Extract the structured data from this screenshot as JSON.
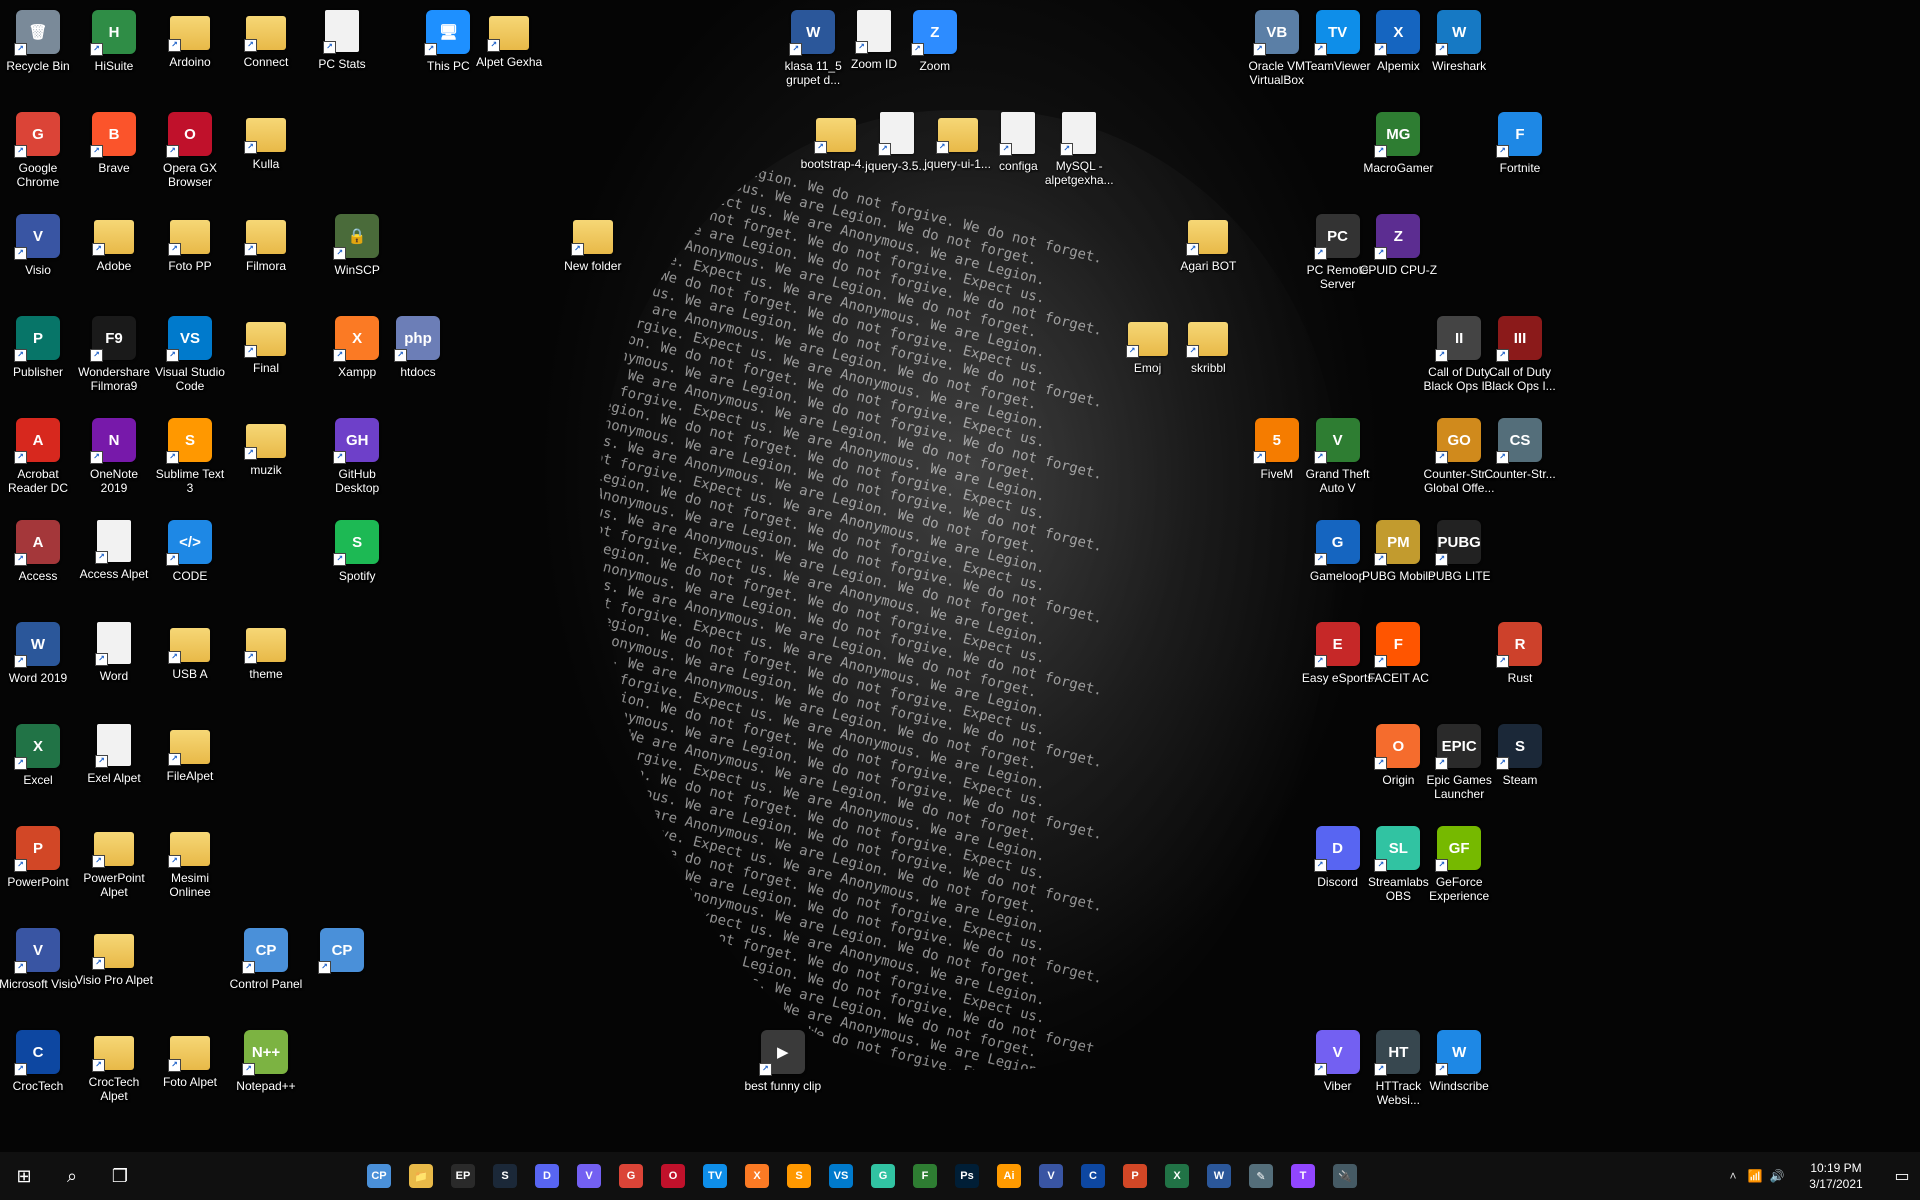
{
  "colors": {
    "taskbar": "#101010",
    "accent": "#0078d7"
  },
  "wallpaper": {
    "lines": [
      "We are Anonymous. We are Legion. We do not forgive. We do not forget.",
      "Expect us. We are Anonymous. We are Legion. We do not forget.",
      "We do not forgive. Expect us. We are Anonymous. We are Legion.",
      "We are Legion. We do not forget. We do not forgive. Expect us.",
      "We are Anonymous. We are Legion. We do not forgive. We do not forget.",
      "Expect us. We are Anonymous. We are Legion. We do not forget.",
      "We do not forgive. Expect us. We are Anonymous. We are Legion.",
      "We are Legion. We do not forget. We do not forgive. Expect us."
    ]
  },
  "desktop_icons": [
    {
      "label": "Recycle Bin",
      "abbr": "🗑",
      "color": "#7a8a99",
      "kind": "app"
    },
    {
      "label": "HiSuite",
      "abbr": "H",
      "color": "#2f8d46",
      "kind": "app"
    },
    {
      "label": "Ardoino",
      "abbr": "",
      "color": "",
      "kind": "folder"
    },
    {
      "label": "Connect",
      "abbr": "",
      "color": "",
      "kind": "folder"
    },
    {
      "label": "PC Stats",
      "abbr": "",
      "color": "",
      "kind": "doc"
    },
    {
      "label": "This PC",
      "abbr": "🖥",
      "color": "#1e90ff",
      "kind": "app"
    },
    {
      "label": "Alpet Gexha",
      "abbr": "",
      "color": "",
      "kind": "folder"
    },
    {
      "label": "klasa 11_5 grupet d...",
      "abbr": "W",
      "color": "#2b579a",
      "kind": "app"
    },
    {
      "label": "Zoom ID",
      "abbr": "",
      "color": "",
      "kind": "doc"
    },
    {
      "label": "Zoom",
      "abbr": "Z",
      "color": "#2d8cff",
      "kind": "app"
    },
    {
      "label": "Oracle VM VirtualBox",
      "abbr": "VB",
      "color": "#5b7fa6",
      "kind": "app"
    },
    {
      "label": "TeamViewer",
      "abbr": "TV",
      "color": "#0e8ee9",
      "kind": "app"
    },
    {
      "label": "Alpemix",
      "abbr": "X",
      "color": "#1565c0",
      "kind": "app"
    },
    {
      "label": "Wireshark",
      "abbr": "W",
      "color": "#1679c4",
      "kind": "app"
    },
    {
      "label": "Google Chrome",
      "abbr": "G",
      "color": "#db4437",
      "kind": "app"
    },
    {
      "label": "Brave",
      "abbr": "B",
      "color": "#fb542b",
      "kind": "app"
    },
    {
      "label": "Opera GX Browser",
      "abbr": "O",
      "color": "#c0112b",
      "kind": "app"
    },
    {
      "label": "Kulla",
      "abbr": "",
      "color": "",
      "kind": "folder"
    },
    {
      "label": "bootstrap-4...",
      "abbr": "",
      "color": "",
      "kind": "folder"
    },
    {
      "label": "jquery-3.5...",
      "abbr": "",
      "color": "",
      "kind": "doc"
    },
    {
      "label": "jquery-ui-1...",
      "abbr": "",
      "color": "",
      "kind": "folder"
    },
    {
      "label": "configa",
      "abbr": "",
      "color": "",
      "kind": "doc"
    },
    {
      "label": "MySQL - alpetgexha...",
      "abbr": "",
      "color": "",
      "kind": "doc"
    },
    {
      "label": "MacroGamer",
      "abbr": "MG",
      "color": "#2e7d32",
      "kind": "app"
    },
    {
      "label": "Fortnite",
      "abbr": "F",
      "color": "#1e88e5",
      "kind": "app"
    },
    {
      "label": "Visio",
      "abbr": "V",
      "color": "#3955a3",
      "kind": "app"
    },
    {
      "label": "Adobe",
      "abbr": "",
      "color": "",
      "kind": "folder"
    },
    {
      "label": "Foto PP",
      "abbr": "",
      "color": "",
      "kind": "folder"
    },
    {
      "label": "Filmora",
      "abbr": "",
      "color": "",
      "kind": "folder"
    },
    {
      "label": "WinSCP",
      "abbr": "🔒",
      "color": "#4a6b3a",
      "kind": "app"
    },
    {
      "label": "New folder",
      "abbr": "",
      "color": "",
      "kind": "folder"
    },
    {
      "label": "Agari BOT",
      "abbr": "",
      "color": "",
      "kind": "folder"
    },
    {
      "label": "PC Remote Server",
      "abbr": "PC",
      "color": "#333333",
      "kind": "app"
    },
    {
      "label": "CPUID CPU-Z",
      "abbr": "Z",
      "color": "#5c2d91",
      "kind": "app"
    },
    {
      "label": "Publisher",
      "abbr": "P",
      "color": "#077568",
      "kind": "app"
    },
    {
      "label": "Wondershare Filmora9",
      "abbr": "F9",
      "color": "#1a1a1a",
      "kind": "app"
    },
    {
      "label": "Visual Studio Code",
      "abbr": "VS",
      "color": "#007acc",
      "kind": "app"
    },
    {
      "label": "Final",
      "abbr": "",
      "color": "",
      "kind": "folder"
    },
    {
      "label": "Xampp",
      "abbr": "X",
      "color": "#fb7a24",
      "kind": "app"
    },
    {
      "label": "htdocs",
      "abbr": "php",
      "color": "#6c7eb7",
      "kind": "app"
    },
    {
      "label": "Emoj",
      "abbr": "",
      "color": "",
      "kind": "folder"
    },
    {
      "label": "skribbl",
      "abbr": "",
      "color": "",
      "kind": "folder"
    },
    {
      "label": "Call of Duty Black Ops I...",
      "abbr": "II",
      "color": "#444444",
      "kind": "app"
    },
    {
      "label": "Call of Duty Black Ops I...",
      "abbr": "III",
      "color": "#8b1a1a",
      "kind": "app"
    },
    {
      "label": "Acrobat Reader DC",
      "abbr": "A",
      "color": "#d7281e",
      "kind": "app"
    },
    {
      "label": "OneNote 2019",
      "abbr": "N",
      "color": "#7719aa",
      "kind": "app"
    },
    {
      "label": "Sublime Text 3",
      "abbr": "S",
      "color": "#ff9800",
      "kind": "app"
    },
    {
      "label": "muzik",
      "abbr": "",
      "color": "",
      "kind": "folder"
    },
    {
      "label": "GitHub Desktop",
      "abbr": "GH",
      "color": "#6e40c9",
      "kind": "app"
    },
    {
      "label": "FiveM",
      "abbr": "5",
      "color": "#f57c00",
      "kind": "app"
    },
    {
      "label": "Grand Theft Auto V",
      "abbr": "V",
      "color": "#2e7d32",
      "kind": "app"
    },
    {
      "label": "Counter-Str... Global Offe...",
      "abbr": "GO",
      "color": "#d08a1c",
      "kind": "app"
    },
    {
      "label": "Counter-Str...",
      "abbr": "CS",
      "color": "#546e7a",
      "kind": "app"
    },
    {
      "label": "Access",
      "abbr": "A",
      "color": "#a4373a",
      "kind": "app"
    },
    {
      "label": "Access Alpet",
      "abbr": "",
      "color": "",
      "kind": "doc"
    },
    {
      "label": "CODE",
      "abbr": "</>",
      "color": "#1e88e5",
      "kind": "app"
    },
    {
      "label": "Spotify",
      "abbr": "S",
      "color": "#1db954",
      "kind": "app"
    },
    {
      "label": "Gameloop",
      "abbr": "G",
      "color": "#1565c0",
      "kind": "app"
    },
    {
      "label": "PUBG Mobile",
      "abbr": "PM",
      "color": "#c29b2e",
      "kind": "app"
    },
    {
      "label": "PUBG LITE",
      "abbr": "PUBG",
      "color": "#222222",
      "kind": "app"
    },
    {
      "label": "Word 2019",
      "abbr": "W",
      "color": "#2b579a",
      "kind": "app"
    },
    {
      "label": "Word",
      "abbr": "",
      "color": "",
      "kind": "doc"
    },
    {
      "label": "USB A",
      "abbr": "",
      "color": "",
      "kind": "folder"
    },
    {
      "label": "theme",
      "abbr": "",
      "color": "",
      "kind": "folder"
    },
    {
      "label": "Easy eSports",
      "abbr": "E",
      "color": "#c62828",
      "kind": "app"
    },
    {
      "label": "FACEIT AC",
      "abbr": "F",
      "color": "#ff5500",
      "kind": "app"
    },
    {
      "label": "Rust",
      "abbr": "R",
      "color": "#cd412b",
      "kind": "app"
    },
    {
      "label": "Excel",
      "abbr": "X",
      "color": "#217346",
      "kind": "app"
    },
    {
      "label": "Exel Alpet",
      "abbr": "",
      "color": "",
      "kind": "doc"
    },
    {
      "label": "FileAlpet",
      "abbr": "",
      "color": "",
      "kind": "folder"
    },
    {
      "label": "Origin",
      "abbr": "O",
      "color": "#f56c2d",
      "kind": "app"
    },
    {
      "label": "Epic Games Launcher",
      "abbr": "EPIC",
      "color": "#2a2a2a",
      "kind": "app"
    },
    {
      "label": "Steam",
      "abbr": "S",
      "color": "#1b2838",
      "kind": "app"
    },
    {
      "label": "PowerPoint",
      "abbr": "P",
      "color": "#d24726",
      "kind": "app"
    },
    {
      "label": "PowerPoint Alpet",
      "abbr": "",
      "color": "",
      "kind": "folder"
    },
    {
      "label": "Mesimi Onlinee",
      "abbr": "",
      "color": "",
      "kind": "folder"
    },
    {
      "label": "Discord",
      "abbr": "D",
      "color": "#5865f2",
      "kind": "app"
    },
    {
      "label": "Streamlabs OBS",
      "abbr": "SL",
      "color": "#31c3a2",
      "kind": "app"
    },
    {
      "label": "GeForce Experience",
      "abbr": "GF",
      "color": "#76b900",
      "kind": "app"
    },
    {
      "label": "Microsoft Visio",
      "abbr": "V",
      "color": "#3955a3",
      "kind": "app"
    },
    {
      "label": "Visio Pro Alpet",
      "abbr": "",
      "color": "",
      "kind": "folder"
    },
    {
      "label": "Control Panel",
      "abbr": "CP",
      "color": "#4a90d9",
      "kind": "app"
    },
    {
      "label": "",
      "abbr": "CP",
      "color": "#4a90d9",
      "kind": "app"
    },
    {
      "label": "CrocTech",
      "abbr": "C",
      "color": "#0d47a1",
      "kind": "app"
    },
    {
      "label": "CrocTech Alpet",
      "abbr": "",
      "color": "",
      "kind": "folder"
    },
    {
      "label": "Foto Alpet",
      "abbr": "",
      "color": "",
      "kind": "folder"
    },
    {
      "label": "Notepad++",
      "abbr": "N++",
      "color": "#7cb342",
      "kind": "app"
    },
    {
      "label": "best funny clip",
      "abbr": "▶",
      "color": "#3a3a3a",
      "kind": "app"
    },
    {
      "label": "Viber",
      "abbr": "V",
      "color": "#7360f2",
      "kind": "app"
    },
    {
      "label": "HTTrack Websi...",
      "abbr": "HT",
      "color": "#37474f",
      "kind": "app"
    },
    {
      "label": "Windscribe",
      "abbr": "W",
      "color": "#1e88e5",
      "kind": "app"
    }
  ],
  "taskbar": {
    "start_glyph": "⊞",
    "search_glyph": "⌕",
    "taskview_glyph": "❐",
    "pinned": [
      {
        "name": "control-panel",
        "abbr": "CP",
        "color": "#4a90d9"
      },
      {
        "name": "file-explorer",
        "abbr": "📁",
        "color": "#e8b948"
      },
      {
        "name": "epic-games",
        "abbr": "EP",
        "color": "#2a2a2a"
      },
      {
        "name": "steam",
        "abbr": "S",
        "color": "#1b2838"
      },
      {
        "name": "discord",
        "abbr": "D",
        "color": "#5865f2"
      },
      {
        "name": "viber",
        "abbr": "V",
        "color": "#7360f2"
      },
      {
        "name": "chrome",
        "abbr": "G",
        "color": "#db4437"
      },
      {
        "name": "opera",
        "abbr": "O",
        "color": "#c0112b"
      },
      {
        "name": "teamviewer",
        "abbr": "TV",
        "color": "#0e8ee9"
      },
      {
        "name": "xampp",
        "abbr": "X",
        "color": "#fb7a24"
      },
      {
        "name": "sublime",
        "abbr": "S",
        "color": "#ff9800"
      },
      {
        "name": "vscode",
        "abbr": "VS",
        "color": "#007acc"
      },
      {
        "name": "gamepad",
        "abbr": "G",
        "color": "#31c3a2"
      },
      {
        "name": "filmora",
        "abbr": "F",
        "color": "#2e7d32"
      },
      {
        "name": "photoshop",
        "abbr": "Ps",
        "color": "#001e36"
      },
      {
        "name": "illustrator",
        "abbr": "Ai",
        "color": "#ff9a00"
      },
      {
        "name": "visio",
        "abbr": "V",
        "color": "#3955a3"
      },
      {
        "name": "croctech",
        "abbr": "C",
        "color": "#0d47a1"
      },
      {
        "name": "powerpoint",
        "abbr": "P",
        "color": "#d24726"
      },
      {
        "name": "excel",
        "abbr": "X",
        "color": "#217346"
      },
      {
        "name": "word",
        "abbr": "W",
        "color": "#2b579a"
      },
      {
        "name": "paint",
        "abbr": "✎",
        "color": "#546e7a"
      },
      {
        "name": "twitch",
        "abbr": "T",
        "color": "#9146ff"
      },
      {
        "name": "network",
        "abbr": "🔌",
        "color": "#455a64"
      }
    ],
    "tray": {
      "chevron": "˄",
      "wifi": "📶",
      "volume": "🔊",
      "time": "10:19 PM",
      "date": "3/17/2021",
      "notification": "▭"
    }
  }
}
